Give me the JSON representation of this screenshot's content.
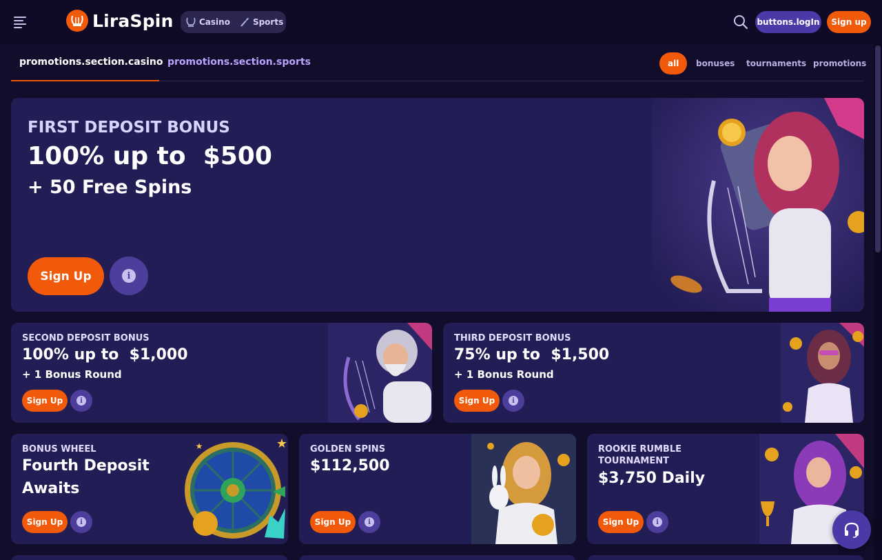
{
  "header": {
    "logo_text": "LiraSpin",
    "modes": [
      {
        "label": "Casino",
        "icon": "lyre-icon"
      },
      {
        "label": "Sports",
        "icon": "torch-icon"
      }
    ],
    "login_label": "buttons.logIn",
    "signup_label": "Sign up"
  },
  "sections": {
    "tabs": [
      {
        "label": "promotions.section.casino",
        "active": true
      },
      {
        "label": "promotions.section.sports",
        "active": false
      }
    ],
    "filters": [
      {
        "label": "all",
        "active": true
      },
      {
        "label": "bonuses",
        "active": false
      },
      {
        "label": "tournaments",
        "active": false
      },
      {
        "label": "promotions",
        "active": false
      }
    ]
  },
  "hero": {
    "eyebrow": "FIRST DEPOSIT BONUS",
    "title": "100% up to  $500",
    "subtitle": "+ 50 Free Spins",
    "cta_label": "Sign Up"
  },
  "cards_row1": [
    {
      "eyebrow": "SECOND DEPOSIT BONUS",
      "title": "100% up to  $1,000",
      "subtitle": "+ 1 Bonus Round",
      "cta_label": "Sign Up"
    },
    {
      "eyebrow": "THIRD DEPOSIT BONUS",
      "title": "75% up to  $1,500",
      "subtitle": "+ 1 Bonus Round",
      "cta_label": "Sign Up"
    }
  ],
  "cards_row2": [
    {
      "eyebrow": "BONUS WHEEL",
      "title_line1": "Fourth Deposit",
      "title_line2": "Awaits",
      "cta_label": "Sign Up"
    },
    {
      "eyebrow": "GOLDEN SPINS",
      "title": "$112,500",
      "cta_label": "Sign Up"
    },
    {
      "eyebrow_line1": "ROOKIE RUMBLE",
      "eyebrow_line2": "TOURNAMENT",
      "title": "$3,750 Daily",
      "cta_label": "Sign Up"
    }
  ],
  "colors": {
    "background": "#110d2b",
    "card": "#231d55",
    "accent": "#f05a0a",
    "secondary": "#4a3aa8",
    "inactive_tab": "#b9a3ff"
  }
}
